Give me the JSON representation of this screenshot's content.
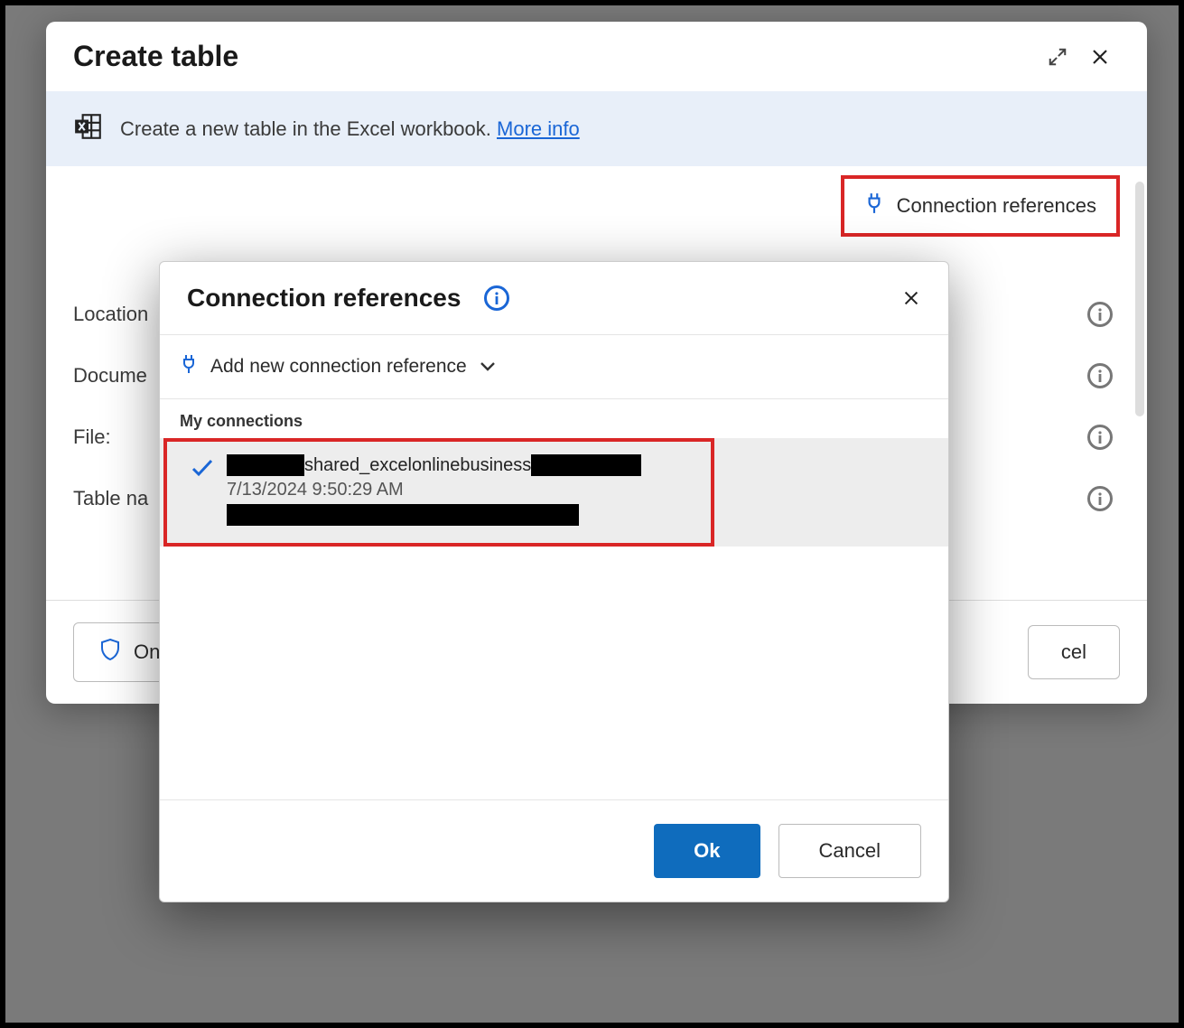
{
  "main": {
    "title": "Create table",
    "banner_text": "Create a new table in the Excel workbook.",
    "banner_link": "More info",
    "conn_ref_button": "Connection references",
    "fields": {
      "location": "Location",
      "document": "Docume",
      "file": "File:",
      "tablename": "Table na"
    },
    "footer": {
      "on": "On",
      "cancel": "cel"
    }
  },
  "popup": {
    "title": "Connection references",
    "add_new": "Add new connection reference",
    "my_connections": "My connections",
    "item": {
      "name": "shared_excelonlinebusiness",
      "date": "7/13/2024 9:50:29 AM"
    },
    "ok": "Ok",
    "cancel": "Cancel"
  }
}
